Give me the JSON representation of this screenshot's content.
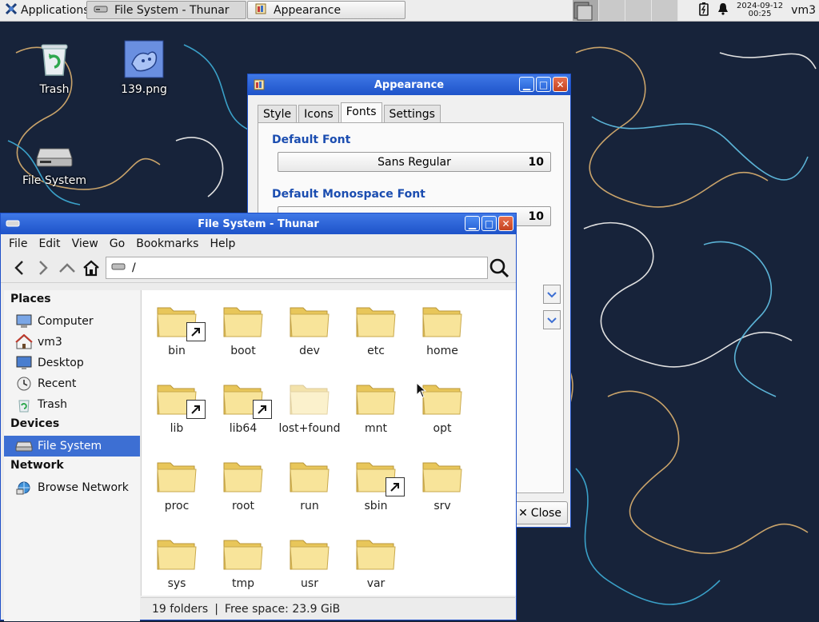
{
  "panel": {
    "applications_label": "Applications",
    "tasks": [
      {
        "label": "File System - Thunar"
      },
      {
        "label": "Appearance"
      }
    ],
    "clock_date": "2024-09-12",
    "clock_time": "00:25",
    "user": "vm3"
  },
  "desktop": {
    "icons": [
      {
        "label": "Trash"
      },
      {
        "label": "139.png"
      },
      {
        "label": "File System"
      }
    ]
  },
  "appearance": {
    "title": "Appearance",
    "tabs": [
      "Style",
      "Icons",
      "Fonts",
      "Settings"
    ],
    "active_tab": "Fonts",
    "default_font_heading": "Default Font",
    "default_font_name": "Sans Regular",
    "default_font_size": "10",
    "mono_font_heading": "Default Monospace Font",
    "mono_font_size": "10",
    "close_label": "Close"
  },
  "thunar": {
    "title": "File System - Thunar",
    "menu": [
      "File",
      "Edit",
      "View",
      "Go",
      "Bookmarks",
      "Help"
    ],
    "path": "/",
    "sidebar": {
      "places_heading": "Places",
      "places": [
        "Computer",
        "vm3",
        "Desktop",
        "Recent",
        "Trash"
      ],
      "devices_heading": "Devices",
      "devices": [
        "File System"
      ],
      "network_heading": "Network",
      "network": [
        "Browse Network"
      ]
    },
    "files": [
      {
        "name": "bin",
        "link": true
      },
      {
        "name": "boot",
        "link": false
      },
      {
        "name": "dev",
        "link": false
      },
      {
        "name": "etc",
        "link": false
      },
      {
        "name": "home",
        "link": false
      },
      {
        "name": "lib",
        "link": true
      },
      {
        "name": "lib64",
        "link": true
      },
      {
        "name": "lost+found",
        "link": false,
        "faded": true
      },
      {
        "name": "mnt",
        "link": false
      },
      {
        "name": "opt",
        "link": false
      },
      {
        "name": "proc",
        "link": false
      },
      {
        "name": "root",
        "link": false
      },
      {
        "name": "run",
        "link": false
      },
      {
        "name": "sbin",
        "link": true
      },
      {
        "name": "srv",
        "link": false
      },
      {
        "name": "sys",
        "link": false
      },
      {
        "name": "tmp",
        "link": false
      },
      {
        "name": "usr",
        "link": false
      },
      {
        "name": "var",
        "link": false
      }
    ],
    "status_count": "19 folders",
    "status_separator": "|",
    "status_free": "Free space: 23.9 GiB"
  },
  "colors": {
    "titlebar": "#1e53c9",
    "selection": "#3d6fd3",
    "section_heading": "#1b4db0",
    "desktop_bg": "#17233a"
  }
}
